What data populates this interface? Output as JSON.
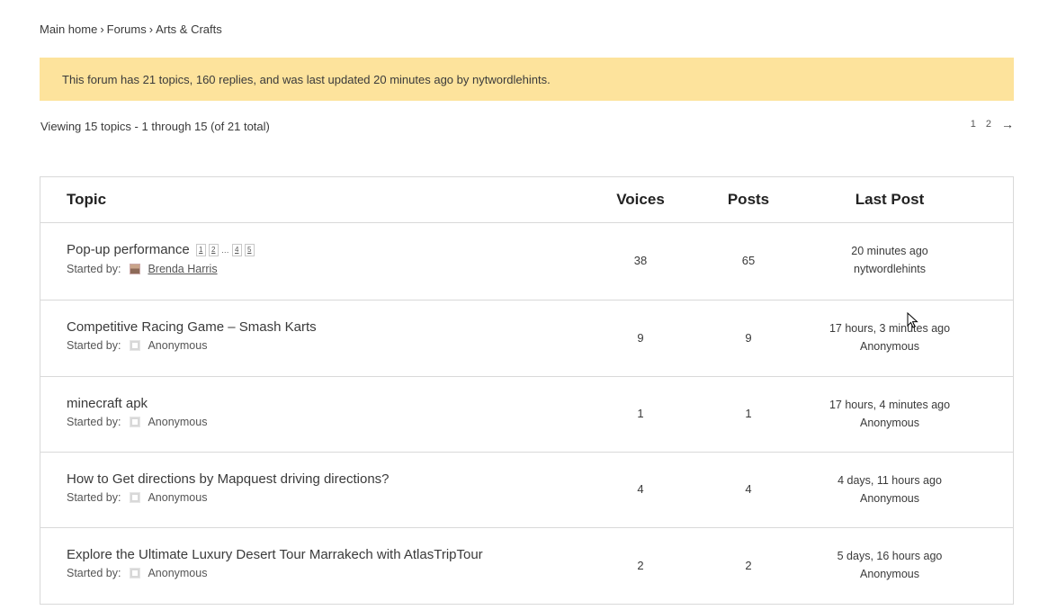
{
  "breadcrumb": {
    "items": [
      "Main home",
      "Forums",
      "Arts & Crafts"
    ],
    "separator": "›"
  },
  "notice": {
    "text": "This forum has 21 topics, 160 replies, and was last updated 20 minutes ago by nytwordlehints."
  },
  "viewing": {
    "text": "Viewing 15 topics - 1 through 15 (of 21 total)"
  },
  "pager": {
    "pages": [
      "1",
      "2"
    ],
    "next": "→"
  },
  "table": {
    "headers": {
      "topic": "Topic",
      "voices": "Voices",
      "posts": "Posts",
      "last_post": "Last Post"
    },
    "started_by_label": "Started by:",
    "rows": [
      {
        "title": "Pop-up performance",
        "mini_pages": [
          "1",
          "2",
          "…",
          "4",
          "5"
        ],
        "author": "Brenda Harris",
        "avatar": "user-photo",
        "voices": "38",
        "posts": "65",
        "last_time": "20 minutes ago",
        "last_author": "nytwordlehints"
      },
      {
        "title": "Competitive Racing Game – Smash Karts",
        "mini_pages": [],
        "author": "Anonymous",
        "avatar": "anonymous",
        "voices": "9",
        "posts": "9",
        "last_time": "17 hours, 3 minutes ago",
        "last_author": "Anonymous"
      },
      {
        "title": "minecraft apk",
        "mini_pages": [],
        "author": "Anonymous",
        "avatar": "anonymous",
        "voices": "1",
        "posts": "1",
        "last_time": "17 hours, 4 minutes ago",
        "last_author": "Anonymous"
      },
      {
        "title": "How to Get directions by Mapquest driving directions?",
        "mini_pages": [],
        "author": "Anonymous",
        "avatar": "anonymous",
        "voices": "4",
        "posts": "4",
        "last_time": "4 days, 11 hours ago",
        "last_author": "Anonymous"
      },
      {
        "title": "Explore the Ultimate Luxury Desert Tour Marrakech with AtlasTripTour",
        "mini_pages": [],
        "author": "Anonymous",
        "avatar": "anonymous",
        "voices": "2",
        "posts": "2",
        "last_time": "5 days, 16 hours ago",
        "last_author": "Anonymous"
      }
    ]
  },
  "colors": {
    "notice_bg": "#fde39c",
    "border": "#d9d9d9",
    "text": "#3a3a3a"
  }
}
